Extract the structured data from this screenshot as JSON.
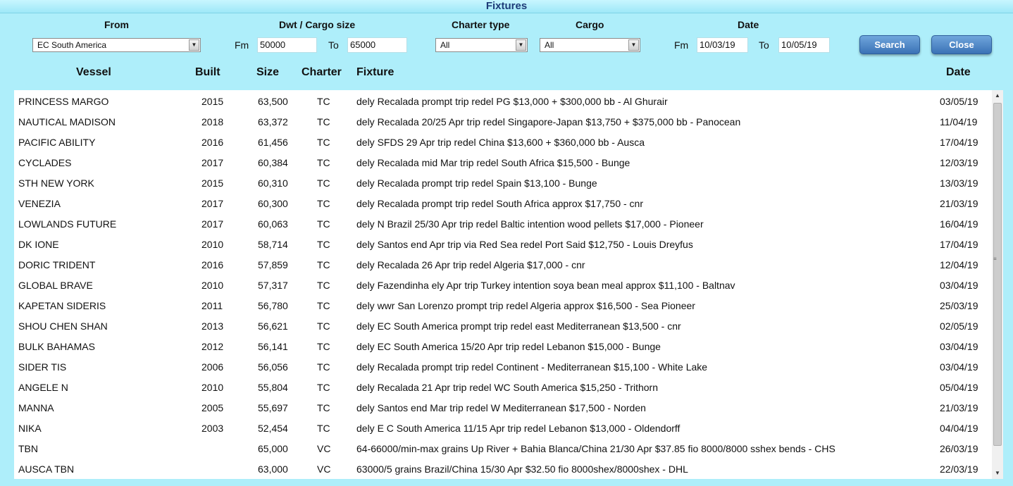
{
  "window": {
    "title": "Fixtures"
  },
  "filters": {
    "from_label": "From",
    "from_value": "EC South America",
    "dwt_label": "Dwt / Cargo size",
    "fm_label": "Fm",
    "dwt_from": "50000",
    "to_label": "To",
    "dwt_to": "65000",
    "charter_type_label": "Charter type",
    "charter_type_value": "All",
    "cargo_label": "Cargo",
    "cargo_value": "All",
    "date_label": "Date",
    "date_fm_label": "Fm",
    "date_from": "10/03/19",
    "date_to_label": "To",
    "date_to": "10/05/19",
    "search_label": "Search",
    "close_label": "Close"
  },
  "table": {
    "headers": {
      "vessel": "Vessel",
      "built": "Built",
      "size": "Size",
      "charter": "Charter",
      "fixture": "Fixture",
      "date": "Date"
    },
    "rows": [
      {
        "vessel": "PRINCESS MARGO",
        "built": "2015",
        "size": "63,500",
        "charter": "TC",
        "fixture": "dely Recalada prompt trip redel PG $13,000 + $300,000 bb - Al Ghurair",
        "date": "03/05/19"
      },
      {
        "vessel": "NAUTICAL MADISON",
        "built": "2018",
        "size": "63,372",
        "charter": "TC",
        "fixture": "dely Recalada 20/25 Apr trip redel Singapore-Japan $13,750 + $375,000 bb - Panocean",
        "date": "11/04/19"
      },
      {
        "vessel": "PACIFIC ABILITY",
        "built": "2016",
        "size": "61,456",
        "charter": "TC",
        "fixture": "dely SFDS 29 Apr trip redel China $13,600 + $360,000 bb - Ausca",
        "date": "17/04/19"
      },
      {
        "vessel": "CYCLADES",
        "built": "2017",
        "size": "60,384",
        "charter": "TC",
        "fixture": "dely Recalada mid Mar trip redel South Africa $15,500 - Bunge",
        "date": "12/03/19"
      },
      {
        "vessel": "STH NEW YORK",
        "built": "2015",
        "size": "60,310",
        "charter": "TC",
        "fixture": "dely Recalada prompt trip redel Spain $13,100 - Bunge",
        "date": "13/03/19"
      },
      {
        "vessel": "VENEZIA",
        "built": "2017",
        "size": "60,300",
        "charter": "TC",
        "fixture": "dely Recalada prompt trip redel South Africa approx $17,750 - cnr",
        "date": "21/03/19"
      },
      {
        "vessel": "LOWLANDS FUTURE",
        "built": "2017",
        "size": "60,063",
        "charter": "TC",
        "fixture": "dely N Brazil 25/30 Apr trip redel Baltic intention wood pellets $17,000 - Pioneer",
        "date": "16/04/19"
      },
      {
        "vessel": "DK IONE",
        "built": "2010",
        "size": "58,714",
        "charter": "TC",
        "fixture": "dely Santos end Apr trip via Red Sea redel Port Said $12,750 - Louis Dreyfus",
        "date": "17/04/19"
      },
      {
        "vessel": "DORIC TRIDENT",
        "built": "2016",
        "size": "57,859",
        "charter": "TC",
        "fixture": "dely Recalada 26 Apr trip redel Algeria $17,000 - cnr",
        "date": "12/04/19"
      },
      {
        "vessel": "GLOBAL BRAVE",
        "built": "2010",
        "size": "57,317",
        "charter": "TC",
        "fixture": "dely Fazendinha ely Apr trip Turkey intention soya bean meal approx $11,100 - Baltnav",
        "date": "03/04/19"
      },
      {
        "vessel": "KAPETAN SIDERIS",
        "built": "2011",
        "size": "56,780",
        "charter": "TC",
        "fixture": "dely wwr San Lorenzo prompt trip redel Algeria approx $16,500 - Sea Pioneer",
        "date": "25/03/19"
      },
      {
        "vessel": "SHOU CHEN SHAN",
        "built": "2013",
        "size": "56,621",
        "charter": "TC",
        "fixture": "dely EC South America prompt trip redel east Mediterranean $13,500 - cnr",
        "date": "02/05/19"
      },
      {
        "vessel": "BULK BAHAMAS",
        "built": "2012",
        "size": "56,141",
        "charter": "TC",
        "fixture": "dely EC South America 15/20 Apr trip redel Lebanon $15,000 - Bunge",
        "date": "03/04/19"
      },
      {
        "vessel": "SIDER TIS",
        "built": "2006",
        "size": "56,056",
        "charter": "TC",
        "fixture": "dely Recalada prompt trip redel Continent - Mediterranean $15,100 - White Lake",
        "date": "03/04/19"
      },
      {
        "vessel": "ANGELE N",
        "built": "2010",
        "size": "55,804",
        "charter": "TC",
        "fixture": "dely Recalada 21 Apr trip redel WC South America $15,250 - Trithorn",
        "date": "05/04/19"
      },
      {
        "vessel": "MANNA",
        "built": "2005",
        "size": "55,697",
        "charter": "TC",
        "fixture": "dely Santos end Mar trip redel W Mediterranean $17,500 - Norden",
        "date": "21/03/19"
      },
      {
        "vessel": "NIKA",
        "built": "2003",
        "size": "52,454",
        "charter": "TC",
        "fixture": "dely E C South America 11/15 Apr trip redel Lebanon $13,000 - Oldendorff",
        "date": "04/04/19"
      },
      {
        "vessel": "TBN",
        "built": "",
        "size": "65,000",
        "charter": "VC",
        "fixture": "64-66000/min-max grains Up River + Bahia Blanca/China 21/30 Apr $37.85 fio 8000/8000 sshex bends - CHS",
        "date": "26/03/19"
      },
      {
        "vessel": "AUSCA TBN",
        "built": "",
        "size": "63,000",
        "charter": "VC",
        "fixture": "63000/5 grains Brazil/China 15/30 Apr $32.50 fio 8000shex/8000shex - DHL",
        "date": "22/03/19"
      }
    ]
  }
}
